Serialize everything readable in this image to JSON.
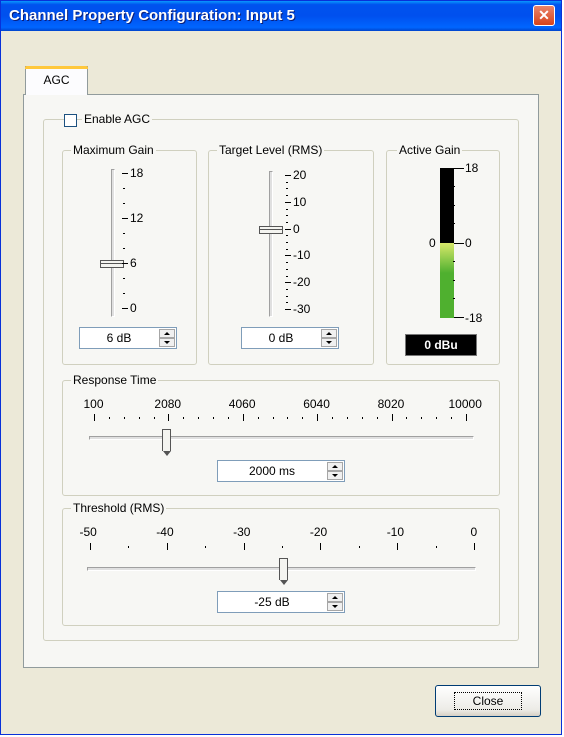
{
  "window": {
    "title": "Channel Property Configuration: Input 5",
    "close_glyph": "✕"
  },
  "tabs": [
    {
      "label": "AGC",
      "selected": true
    }
  ],
  "agc": {
    "enable_label": "Enable AGC",
    "enable_checked": false,
    "max_gain": {
      "legend": "Maximum Gain",
      "ticks": [
        "18",
        "12",
        "6",
        "0"
      ],
      "value": "6 dB",
      "level": 6,
      "range": [
        0,
        18
      ]
    },
    "target_level": {
      "legend": "Target Level (RMS)",
      "ticks": [
        "20",
        "10",
        "0",
        "-10",
        "-20",
        "-30"
      ],
      "value": "0 dB",
      "level": 0,
      "range": [
        -30,
        20
      ]
    },
    "active_gain": {
      "legend": "Active Gain",
      "scale_top": "18",
      "scale_mid_left": "0",
      "scale_mid_right": "0",
      "scale_bottom": "-18",
      "readout": "0 dBu",
      "level": 0,
      "range": [
        -18,
        18
      ],
      "fill_color": "#4fb02f"
    },
    "response_time": {
      "legend": "Response Time",
      "ticks": [
        "100",
        "2080",
        "4060",
        "6040",
        "8020",
        "10000"
      ],
      "value": "2000 ms",
      "level": 2000,
      "range": [
        100,
        10000
      ]
    },
    "threshold": {
      "legend": "Threshold (RMS)",
      "ticks": [
        "-50",
        "-40",
        "-30",
        "-20",
        "-10",
        "0"
      ],
      "value": "-25 dB",
      "level": -25,
      "range": [
        -50,
        0
      ]
    }
  },
  "buttons": {
    "close_label": "Close"
  }
}
